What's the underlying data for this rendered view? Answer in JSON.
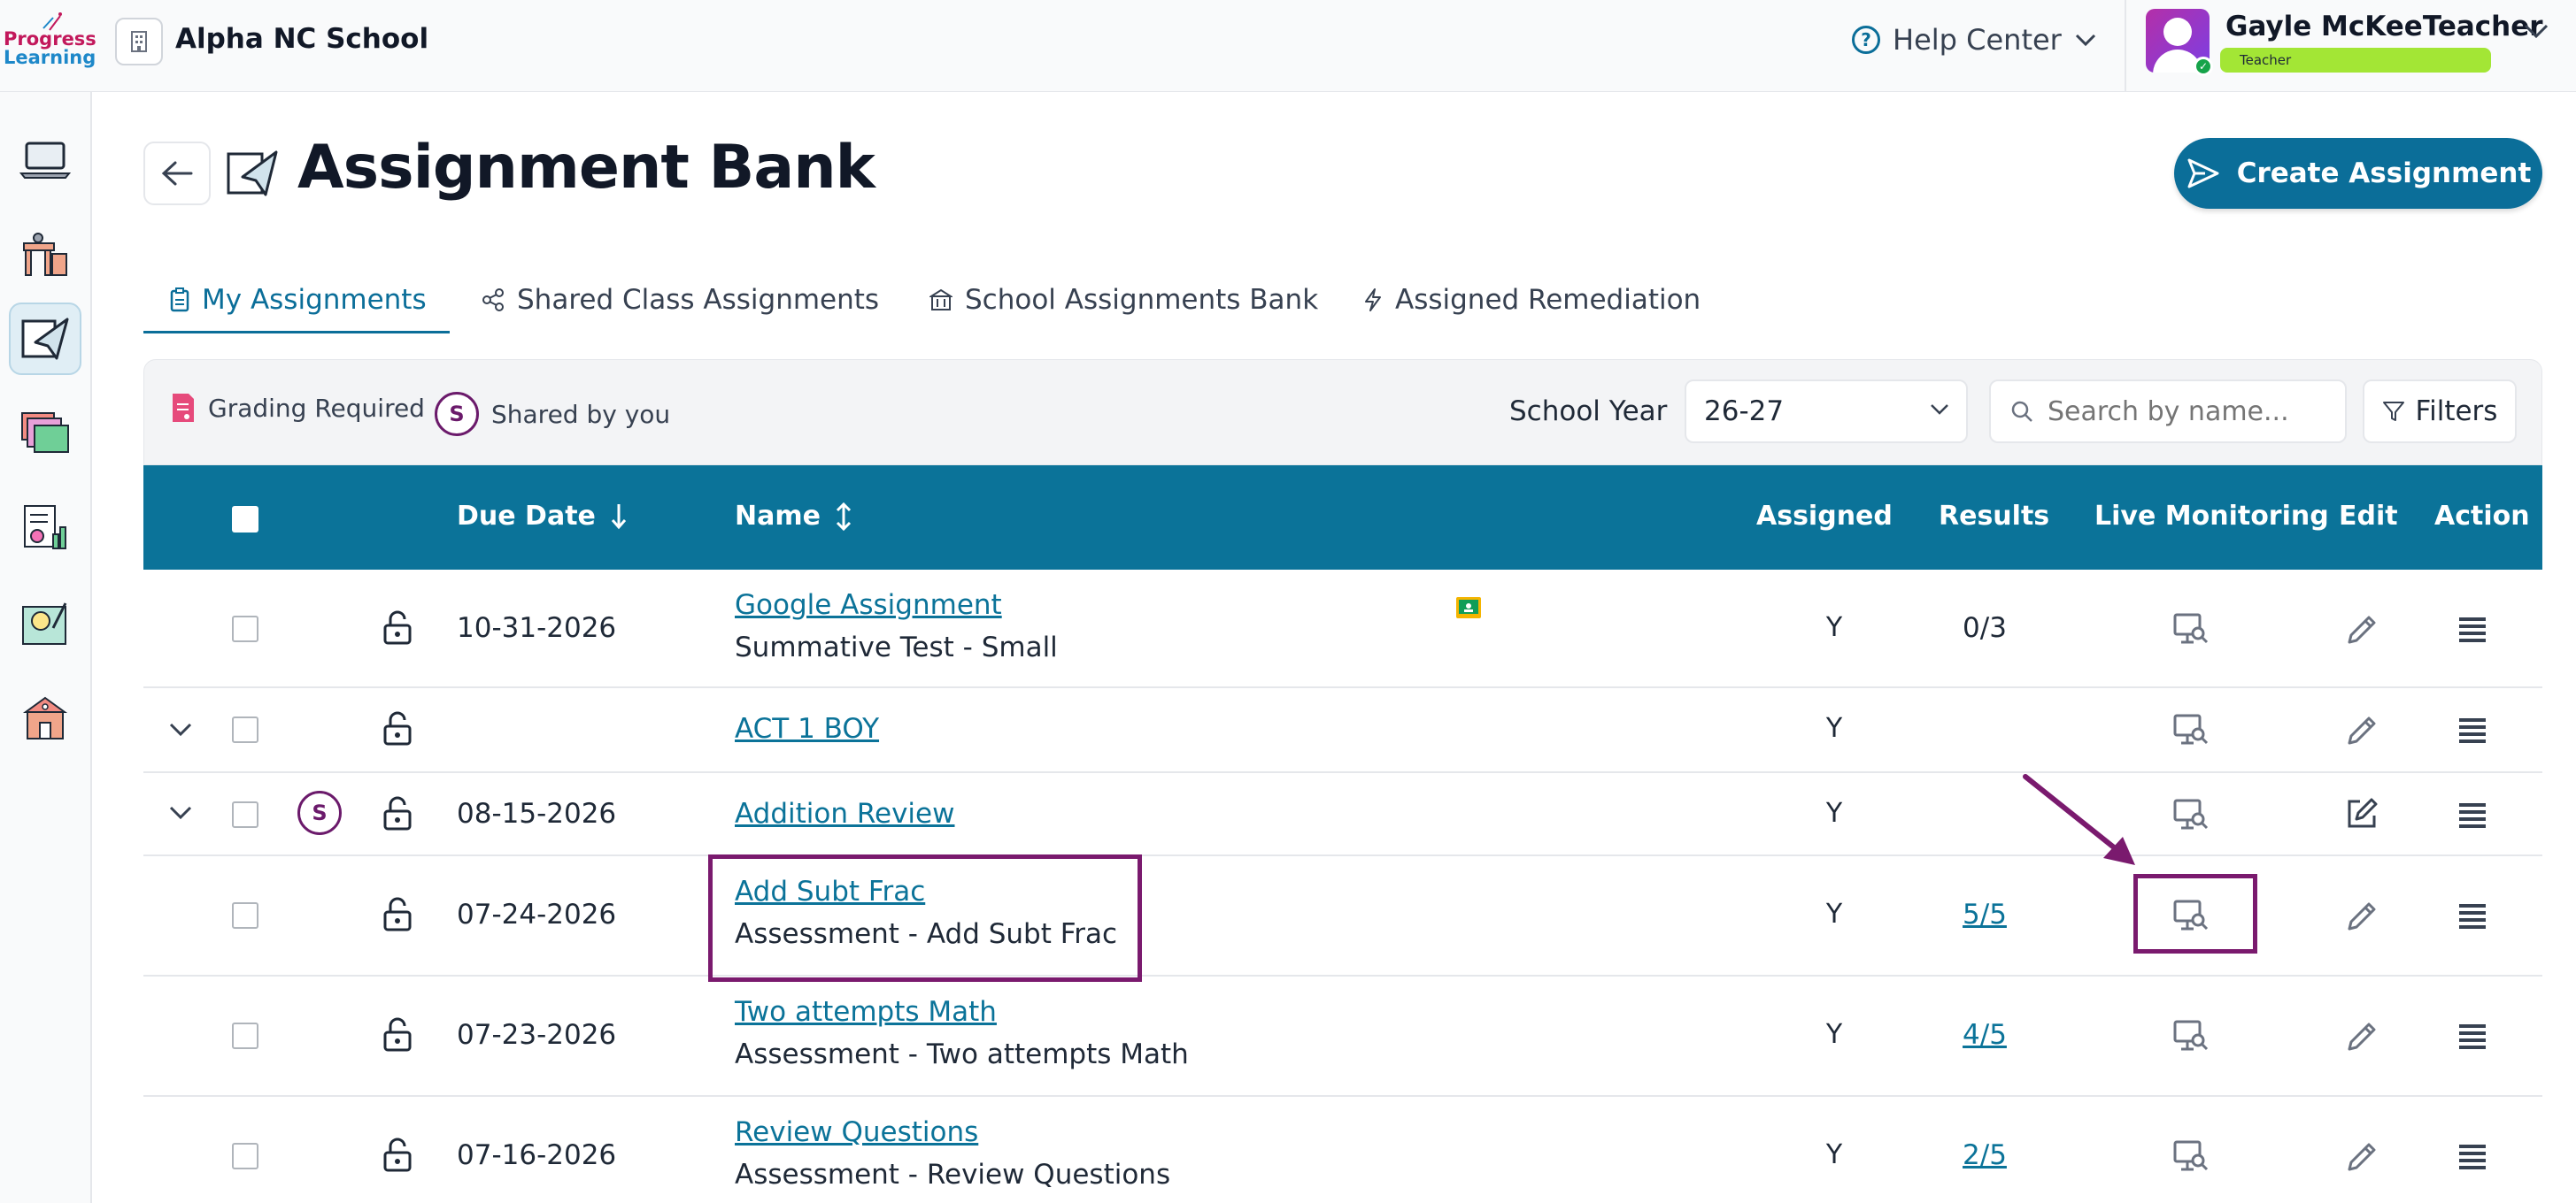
{
  "header": {
    "logo_line1": "Progress",
    "logo_line2": "Learning",
    "school_name": "Alpha NC School",
    "help_label": "Help Center",
    "user_name": "Gayle McKeeTeacher",
    "user_role": "Teacher"
  },
  "page": {
    "title": "Assignment Bank",
    "create_label": "Create Assignment"
  },
  "tabs": [
    {
      "label": "My Assignments",
      "active": true
    },
    {
      "label": "Shared Class Assignments",
      "active": false
    },
    {
      "label": "School Assignments Bank",
      "active": false
    },
    {
      "label": "Assigned Remediation",
      "active": false
    }
  ],
  "filters": {
    "grading_required_label": "Grading Required",
    "shared_badge_letter": "S",
    "shared_by_you_label": "Shared by you",
    "school_year_label": "School Year",
    "school_year_value": "26-27",
    "search_placeholder": "Search by name...",
    "filters_label": "Filters"
  },
  "table": {
    "columns": {
      "due_date": "Due Date",
      "name": "Name",
      "assigned": "Assigned",
      "results": "Results",
      "live_monitoring": "Live Monitoring",
      "edit": "Edit",
      "action": "Action"
    },
    "rows": [
      {
        "due": "10-31-2026",
        "name": "Google Assignment",
        "sub": "Summative Test - Small",
        "assigned": "Y",
        "results": "0/3",
        "results_link": false,
        "expandable": false,
        "shared": false,
        "google_classroom": true
      },
      {
        "due": "",
        "name": "ACT 1 BOY",
        "sub": "",
        "assigned": "Y",
        "results": "",
        "results_link": false,
        "expandable": true,
        "shared": false,
        "google_classroom": false
      },
      {
        "due": "08-15-2026",
        "name": "Addition Review",
        "sub": "",
        "assigned": "Y",
        "results": "",
        "results_link": false,
        "expandable": true,
        "shared": true,
        "google_classroom": false
      },
      {
        "due": "07-24-2026",
        "name": "Add Subt Frac",
        "sub": "Assessment - Add Subt Frac",
        "assigned": "Y",
        "results": "5/5",
        "results_link": true,
        "expandable": false,
        "shared": false,
        "google_classroom": false
      },
      {
        "due": "07-23-2026",
        "name": "Two attempts Math",
        "sub": "Assessment - Two attempts Math",
        "assigned": "Y",
        "results": "4/5",
        "results_link": true,
        "expandable": false,
        "shared": false,
        "google_classroom": false
      },
      {
        "due": "07-16-2026",
        "name": "Review Questions",
        "sub": "Assessment - Review Questions",
        "assigned": "Y",
        "results": "2/5",
        "results_link": true,
        "expandable": false,
        "shared": false,
        "google_classroom": false
      }
    ]
  },
  "colors": {
    "primary": "#0b7399",
    "annotation": "#7a1a6e",
    "badge": "#a3e635"
  }
}
